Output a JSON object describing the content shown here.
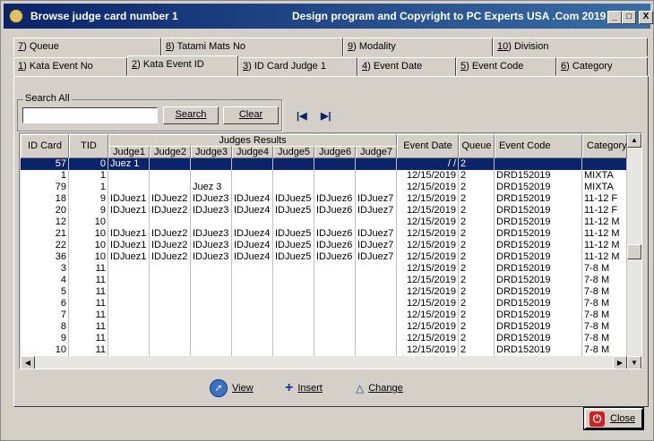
{
  "window": {
    "title": "Browse judge card number 1",
    "copyright": "Design program and Copyright to PC Experts USA .Com 2019 ©",
    "minimize": "_",
    "maximize": "□",
    "close": "X"
  },
  "tabs_top": [
    {
      "key": "7",
      "label": ") Queue"
    },
    {
      "key": "8",
      "label": ") Tatami Mats No"
    },
    {
      "key": "9",
      "label": ") Modality"
    },
    {
      "key": "10",
      "label": ") Division"
    }
  ],
  "tabs_bottom": [
    {
      "key": "1",
      "label": ") Kata Event No"
    },
    {
      "key": "2",
      "label": ") Kata Event ID"
    },
    {
      "key": "3",
      "label": ") ID Card Judge 1"
    },
    {
      "key": "4",
      "label": ") Event Date"
    },
    {
      "key": "5",
      "label": ") Event Code"
    },
    {
      "key": "6",
      "label": ") Category"
    }
  ],
  "search": {
    "group_label": "Search All",
    "value": "",
    "search_button": "Search",
    "clear_button": "Clear",
    "first_icon": "first-record-icon",
    "last_icon": "last-record-icon"
  },
  "grid": {
    "headers": {
      "id_card": "ID Card",
      "tid": "TID",
      "judges_results": "Judges Results",
      "judges": [
        "Judge1",
        "Judge2",
        "Judge3",
        "Judge4",
        "Judge5",
        "Judge6",
        "Judge7"
      ],
      "event_date": "Event Date",
      "queue": "Queue",
      "event_code": "Event Code",
      "category": "Category"
    },
    "rows": [
      {
        "id": "57",
        "tid": "0",
        "j": [
          "Juez 1",
          "",
          "",
          "",
          "",
          "",
          ""
        ],
        "date": "/ /",
        "queue": "2",
        "code": "",
        "cat": "",
        "selected": true
      },
      {
        "id": "1",
        "tid": "1",
        "j": [
          "",
          "",
          "",
          "",
          "",
          "",
          ""
        ],
        "date": "12/15/2019",
        "queue": "2",
        "code": "DRD152019",
        "cat": "MIXTA"
      },
      {
        "id": "79",
        "tid": "1",
        "j": [
          "",
          "",
          "Juez 3",
          "",
          "",
          "",
          ""
        ],
        "date": "12/15/2019",
        "queue": "2",
        "code": "DRD152019",
        "cat": "MIXTA"
      },
      {
        "id": "18",
        "tid": "9",
        "j": [
          "IDJuez1",
          "IDJuez2",
          "IDJuez3",
          "IDJuez4",
          "IDJuez5",
          "IDJuez6",
          "IDJuez7"
        ],
        "date": "12/15/2019",
        "queue": "2",
        "code": "DRD152019",
        "cat": "11-12 F"
      },
      {
        "id": "20",
        "tid": "9",
        "j": [
          "IDJuez1",
          "IDJuez2",
          "IDJuez3",
          "IDJuez4",
          "IDJuez5",
          "IDJuez6",
          "IDJuez7"
        ],
        "date": "12/15/2019",
        "queue": "2",
        "code": "DRD152019",
        "cat": "11-12 F"
      },
      {
        "id": "12",
        "tid": "10",
        "j": [
          "",
          "",
          "",
          "",
          "",
          "",
          ""
        ],
        "date": "12/15/2019",
        "queue": "2",
        "code": "DRD152019",
        "cat": "11-12 M"
      },
      {
        "id": "21",
        "tid": "10",
        "j": [
          "IDJuez1",
          "IDJuez2",
          "IDJuez3",
          "IDJuez4",
          "IDJuez5",
          "IDJuez6",
          "IDJuez7"
        ],
        "date": "12/15/2019",
        "queue": "2",
        "code": "DRD152019",
        "cat": "11-12 M"
      },
      {
        "id": "22",
        "tid": "10",
        "j": [
          "IDJuez1",
          "IDJuez2",
          "IDJuez3",
          "IDJuez4",
          "IDJuez5",
          "IDJuez6",
          "IDJuez7"
        ],
        "date": "12/15/2019",
        "queue": "2",
        "code": "DRD152019",
        "cat": "11-12 M"
      },
      {
        "id": "36",
        "tid": "10",
        "j": [
          "IDJuez1",
          "IDJuez2",
          "IDJuez3",
          "IDJuez4",
          "IDJuez5",
          "IDJuez6",
          "IDJuez7"
        ],
        "date": "12/15/2019",
        "queue": "2",
        "code": "DRD152019",
        "cat": "11-12 M"
      },
      {
        "id": "3",
        "tid": "11",
        "j": [
          "",
          "",
          "",
          "",
          "",
          "",
          ""
        ],
        "date": "12/15/2019",
        "queue": "2",
        "code": "DRD152019",
        "cat": "7-8 M"
      },
      {
        "id": "4",
        "tid": "11",
        "j": [
          "",
          "",
          "",
          "",
          "",
          "",
          ""
        ],
        "date": "12/15/2019",
        "queue": "2",
        "code": "DRD152019",
        "cat": "7-8 M"
      },
      {
        "id": "5",
        "tid": "11",
        "j": [
          "",
          "",
          "",
          "",
          "",
          "",
          ""
        ],
        "date": "12/15/2019",
        "queue": "2",
        "code": "DRD152019",
        "cat": "7-8 M"
      },
      {
        "id": "6",
        "tid": "11",
        "j": [
          "",
          "",
          "",
          "",
          "",
          "",
          ""
        ],
        "date": "12/15/2019",
        "queue": "2",
        "code": "DRD152019",
        "cat": "7-8 M"
      },
      {
        "id": "7",
        "tid": "11",
        "j": [
          "",
          "",
          "",
          "",
          "",
          "",
          ""
        ],
        "date": "12/15/2019",
        "queue": "2",
        "code": "DRD152019",
        "cat": "7-8 M"
      },
      {
        "id": "8",
        "tid": "11",
        "j": [
          "",
          "",
          "",
          "",
          "",
          "",
          ""
        ],
        "date": "12/15/2019",
        "queue": "2",
        "code": "DRD152019",
        "cat": "7-8 M"
      },
      {
        "id": "9",
        "tid": "11",
        "j": [
          "",
          "",
          "",
          "",
          "",
          "",
          ""
        ],
        "date": "12/15/2019",
        "queue": "2",
        "code": "DRD152019",
        "cat": "7-8 M"
      },
      {
        "id": "10",
        "tid": "11",
        "j": [
          "",
          "",
          "",
          "",
          "",
          "",
          ""
        ],
        "date": "12/15/2019",
        "queue": "2",
        "code": "DRD152019",
        "cat": "7-8 M"
      }
    ]
  },
  "actions": {
    "view": "View",
    "insert": "Insert",
    "change": "Change",
    "close": "Close"
  },
  "colors": {
    "title_bar": "#0a246a",
    "selected_row": "#0a246a",
    "face": "#d4d0c8",
    "close_icon": "#d02020"
  }
}
